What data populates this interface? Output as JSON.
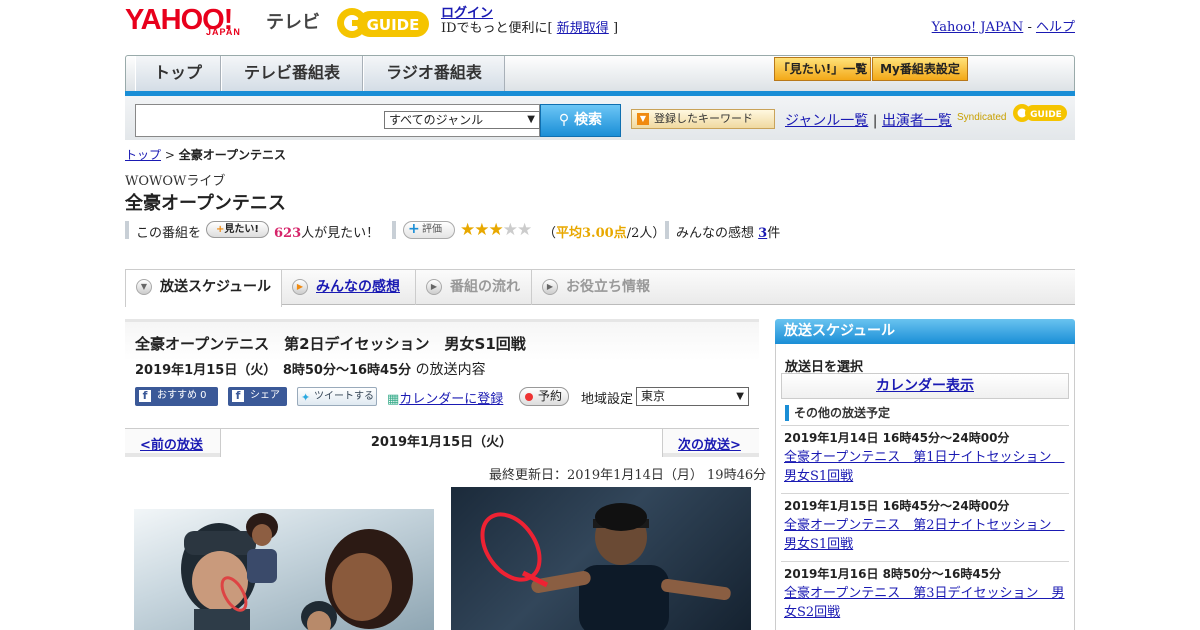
{
  "header": {
    "yahoo_logo": "YAHOO!",
    "yahoo_sub": "JAPAN",
    "tv_label": "テレビ",
    "gguide_logo": "GUIDE",
    "login": "ログイン",
    "id_text_prefix": "IDでもっと便利に[",
    "signup": "新規取得",
    "id_text_suffix": "]",
    "yahoo_japan_link": "Yahoo! JAPAN",
    "separator": "-",
    "help_link": "ヘルプ"
  },
  "nav": {
    "tabs": [
      "トップ",
      "テレビ番組表",
      "ラジオ番組表"
    ],
    "mitai_list": "「見たい!」一覧",
    "my_schedule": "My番組表設定"
  },
  "search": {
    "genre_selected": "すべてのジャンル",
    "button": "検索",
    "keyword_button": "登録したキーワード",
    "genre_list": "ジャンル一覧",
    "divider": "|",
    "performer_list": "出演者一覧",
    "syndicated": "Syndicated"
  },
  "breadcrumb": {
    "home": "トップ",
    "sep": ">",
    "current": "全豪オープンテニス"
  },
  "program": {
    "channel": "WOWOWライブ",
    "title": "全豪オープンテニス",
    "this_program": "この番組を",
    "mitai_btn": "見たい!",
    "mitai_count": "623",
    "mitai_suffix": "人が見たい！",
    "rating_btn": "評価",
    "rating_value": 3,
    "rating_max": 5,
    "avg_open": "（",
    "avg_text": "平均3.00点",
    "avg_count": "/2人）",
    "impressions_label": "みんなの感想",
    "impressions_count": "3",
    "impressions_suffix": "件"
  },
  "tabs": [
    {
      "label": "放送スケジュール",
      "state": "active"
    },
    {
      "label": "みんなの感想",
      "state": "link"
    },
    {
      "label": "番組の流れ",
      "state": "disabled"
    },
    {
      "label": "お役立ち情報",
      "state": "disabled"
    }
  ],
  "episode": {
    "title": "全豪オープンテニス　第2日デイセッション　男女S1回戦",
    "date": "2019年1月15日（火）　8時50分～16時45分",
    "date_suffix": "の放送内容",
    "fb_recommend": "おすすめ 0",
    "fb_share": "シェア",
    "tweet": "ツイートする",
    "calendar_register": "カレンダーに登録",
    "reserve": "予約",
    "region_label": "地域設定",
    "region_value": "東京",
    "prev": "<前の放送",
    "nav_date": "2019年1月15日（火）",
    "next": "次の放送>",
    "updated": "最終更新日：2019年1月14日（月）  19時46分"
  },
  "sidebar": {
    "header": "放送スケジュール",
    "select_date": "放送日を選択",
    "calendar_btn": "カレンダー表示",
    "other_header": "その他の放送予定",
    "items": [
      {
        "when": "2019年1月14日  16時45分～24時00分",
        "what": "全豪オープンテニス　第1日ナイトセッション　男女S1回戦"
      },
      {
        "when": "2019年1月15日  16時45分～24時00分",
        "what": "全豪オープンテニス　第2日ナイトセッション　男女S1回戦"
      },
      {
        "when": "2019年1月16日  8時50分～16時45分",
        "what": "全豪オープンテニス　第3日デイセッション　男女S2回戦"
      }
    ]
  },
  "colors": {
    "accent_blue": "#1a8ed6",
    "yahoo_red": "#e8001c",
    "star": "#e8a800",
    "pink_count": "#d6246a",
    "link": "#1a1ab3"
  }
}
